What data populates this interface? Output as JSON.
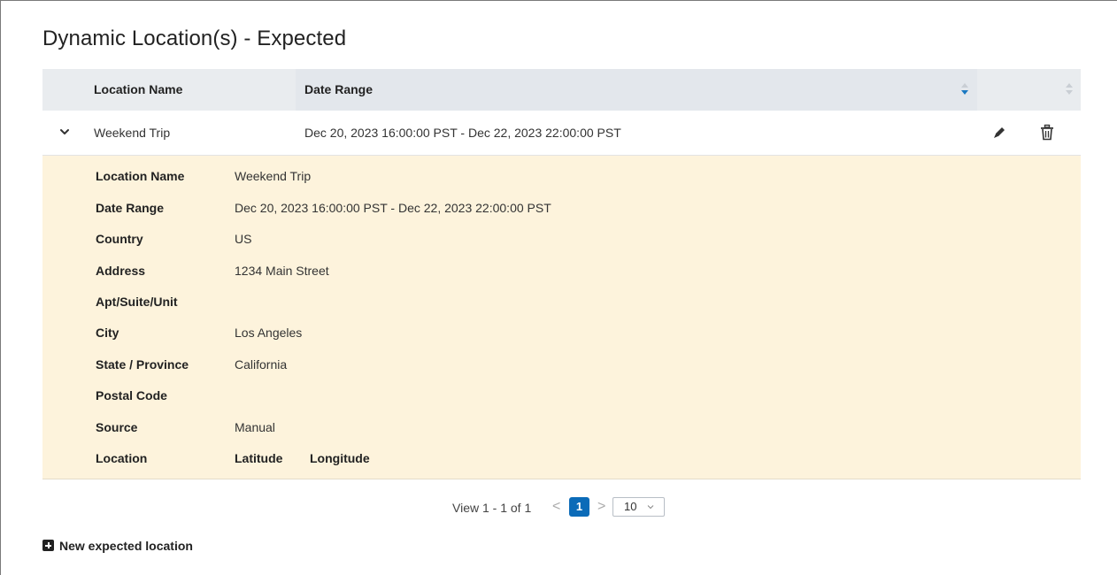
{
  "page": {
    "title": "Dynamic Location(s) - Expected"
  },
  "table": {
    "columns": [
      {
        "label": "Location Name"
      },
      {
        "label": "Date Range",
        "sorted": "descending"
      }
    ],
    "rows": [
      {
        "name": "Weekend Trip",
        "date_range": "Dec 20, 2023 16:00:00 PST - Dec 22, 2023 22:00:00 PST",
        "expanded": true
      }
    ],
    "row_actions": [
      "pencil-icon",
      "trash-icon"
    ]
  },
  "details": {
    "location_name": {
      "label": "Location Name",
      "value": "Weekend Trip"
    },
    "date_range": {
      "label": "Date Range",
      "value": "Dec 20, 2023 16:00:00 PST - Dec 22, 2023 22:00:00 PST"
    },
    "country": {
      "label": "Country",
      "value": "US"
    },
    "address": {
      "label": "Address",
      "value": "1234 Main Street"
    },
    "apt": {
      "label": "Apt/Suite/Unit",
      "value": ""
    },
    "city": {
      "label": "City",
      "value": "Los Angeles"
    },
    "state": {
      "label": "State / Province",
      "value": "California"
    },
    "postal": {
      "label": "Postal Code",
      "value": ""
    },
    "source": {
      "label": "Source",
      "value": "Manual"
    },
    "location": {
      "label": "Location",
      "latitude_label": "Latitude",
      "longitude_label": "Longitude"
    }
  },
  "pagination": {
    "summary": "View 1 - 1 of 1",
    "prev": "<",
    "current_page": "1",
    "next": ">",
    "page_size": "10"
  },
  "actions": {
    "new_location": "New expected location"
  },
  "colors": {
    "header_bg": "#e9ecef",
    "detail_bg": "#fdf3dc",
    "accent": "#0b6bb8"
  }
}
